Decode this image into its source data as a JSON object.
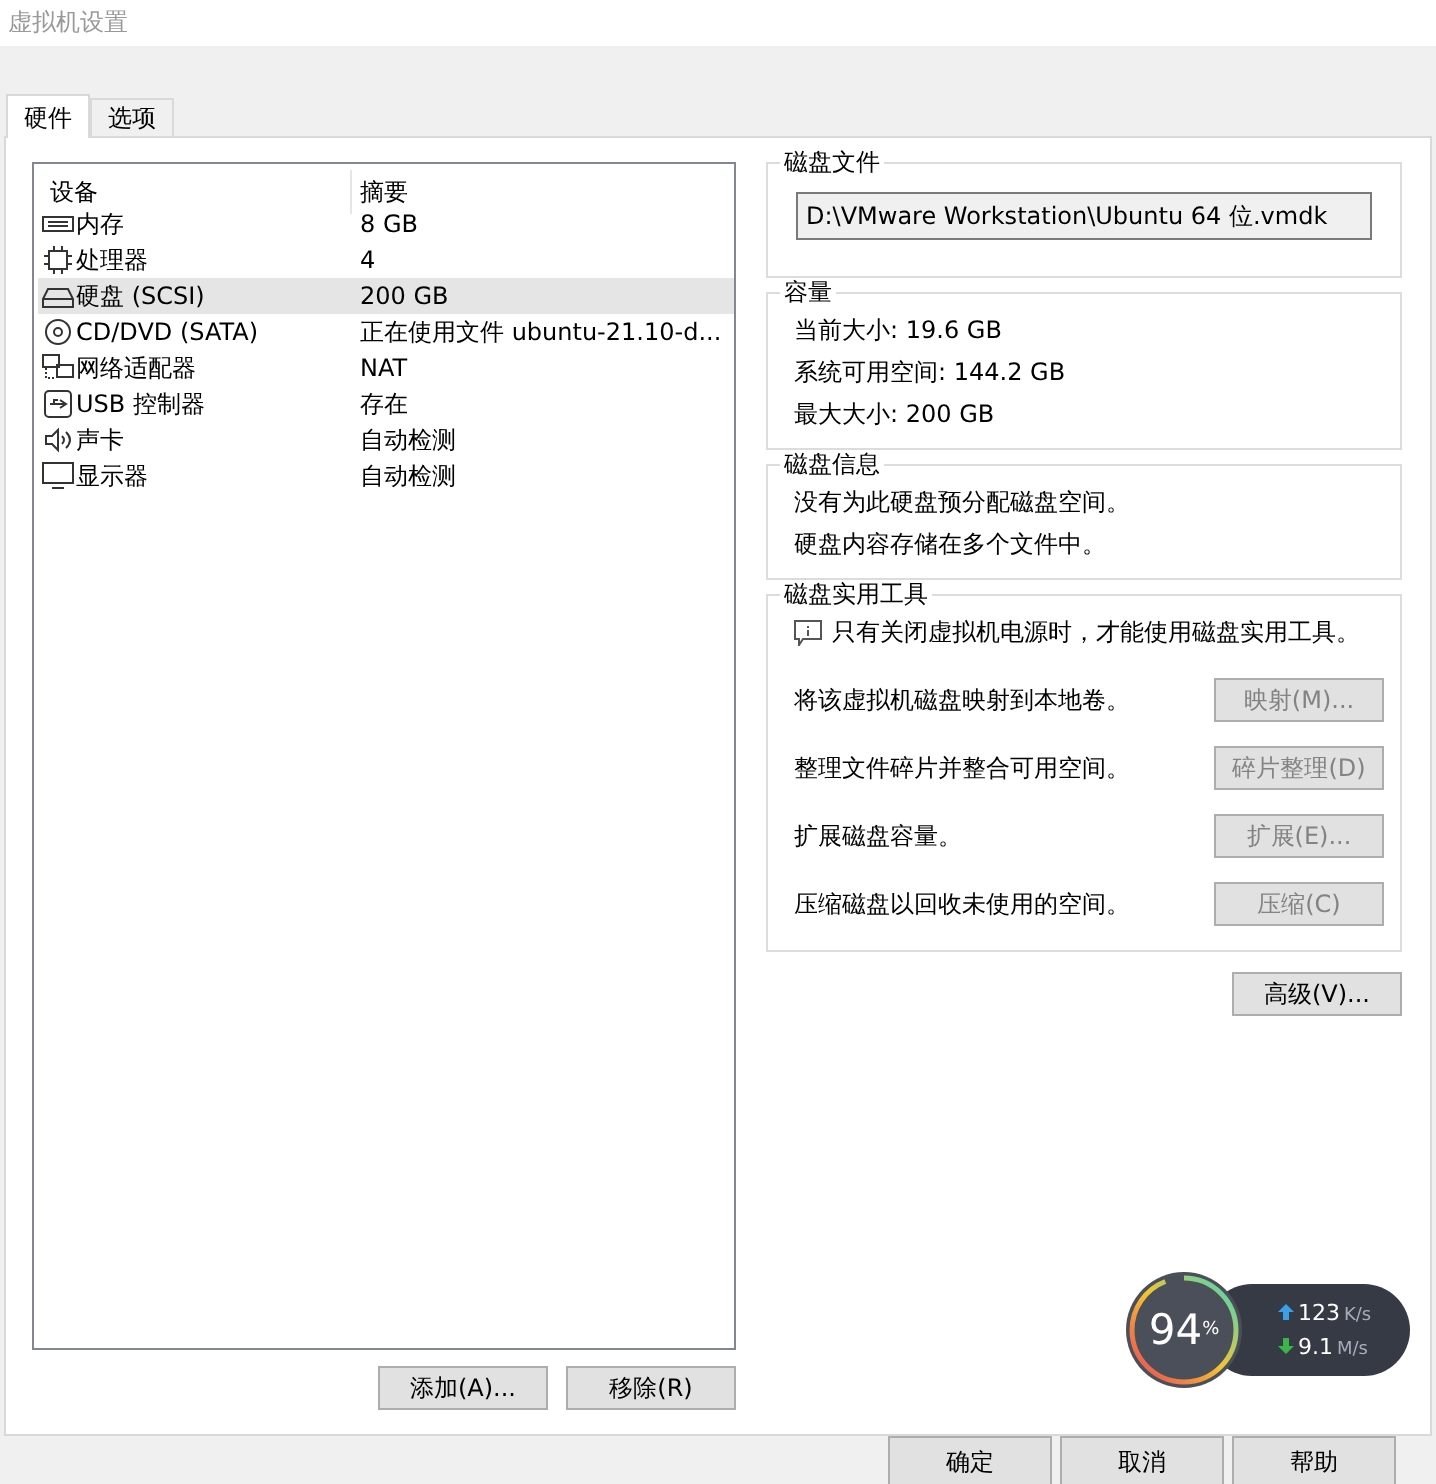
{
  "window": {
    "title": "虚拟机设置"
  },
  "tabs": [
    {
      "label": "硬件",
      "selected": true
    },
    {
      "label": "选项",
      "selected": false
    }
  ],
  "devices": {
    "columns": [
      "设备",
      "摘要"
    ],
    "rows": [
      {
        "kind": "memory",
        "name": "内存",
        "summary": "8 GB",
        "selected": false
      },
      {
        "kind": "cpu",
        "name": "处理器",
        "summary": "4",
        "selected": false
      },
      {
        "kind": "disk",
        "name": "硬盘 (SCSI)",
        "summary": "200 GB",
        "selected": true
      },
      {
        "kind": "cd",
        "name": "CD/DVD (SATA)",
        "summary": "正在使用文件 ubuntu-21.10-d...",
        "selected": false
      },
      {
        "kind": "network",
        "name": "网络适配器",
        "summary": "NAT",
        "selected": false
      },
      {
        "kind": "usb",
        "name": "USB 控制器",
        "summary": "存在",
        "selected": false
      },
      {
        "kind": "sound",
        "name": "声卡",
        "summary": "自动检测",
        "selected": false
      },
      {
        "kind": "display",
        "name": "显示器",
        "summary": "自动检测",
        "selected": false
      }
    ],
    "buttons": [
      "添加(A)...",
      "移除(R)"
    ]
  },
  "disk_file": {
    "title": "磁盘文件",
    "value": "D:\\VMware Workstation\\Ubuntu 64 位.vmdk"
  },
  "capacity": {
    "title": "容量",
    "lines": [
      "当前大小: 19.6 GB",
      "系统可用空间: 144.2 GB",
      "最大大小: 200 GB"
    ]
  },
  "disk_info": {
    "title": "磁盘信息",
    "lines": [
      "没有为此硬盘预分配磁盘空间。",
      "硬盘内容存储在多个文件中。"
    ]
  },
  "utilities": {
    "title": "磁盘实用工具",
    "notice": "只有关闭虚拟机电源时，才能使用磁盘实用工具。",
    "actions": [
      {
        "label": "将该虚拟机磁盘映射到本地卷。",
        "button": "映射(M)...",
        "disabled": true
      },
      {
        "label": "整理文件碎片并整合可用空间。",
        "button": "碎片整理(D)",
        "disabled": true
      },
      {
        "label": "扩展磁盘容量。",
        "button": "扩展(E)...",
        "disabled": true
      },
      {
        "label": "压缩磁盘以回收未使用的空间。",
        "button": "压缩(C)",
        "disabled": true
      }
    ]
  },
  "advanced_button": "高级(V)...",
  "speed_widget": {
    "percent": "94",
    "percent_unit": "%",
    "level": 0.94,
    "upload": "123",
    "upload_unit": "K/s",
    "download": "9.1",
    "download_unit": "M/s"
  },
  "dialog_buttons": [
    "确定",
    "取消",
    "帮助"
  ]
}
